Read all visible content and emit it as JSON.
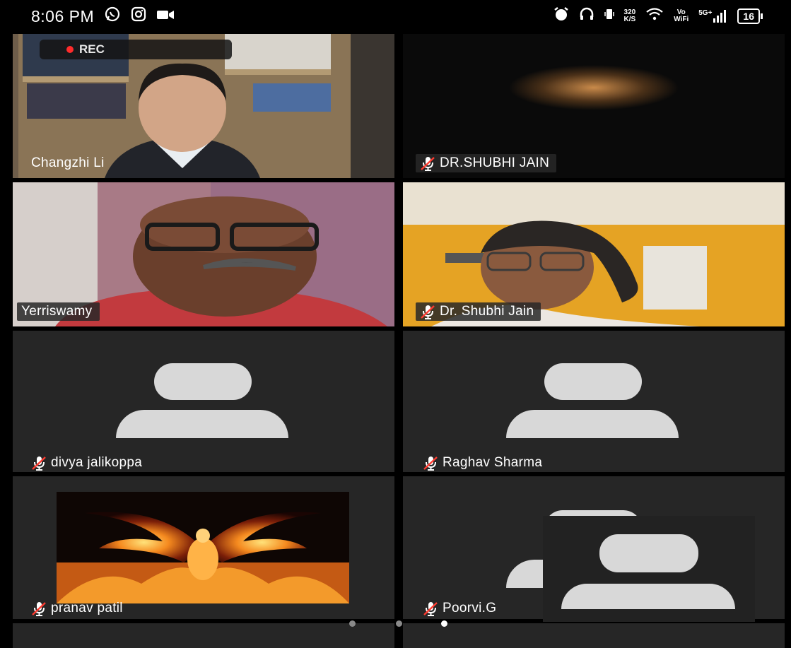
{
  "status_bar": {
    "time": "8:06 PM",
    "network_speed_value": "320",
    "network_speed_unit": "K/S",
    "vowifi_top": "Vo",
    "vowifi_bottom": "WiFi",
    "signal_label": "5G+",
    "battery": "16"
  },
  "recording": {
    "label": "REC"
  },
  "participants": [
    {
      "name": "Changzhi Li",
      "muted": false,
      "video": true
    },
    {
      "name": "DR.SHUBHI JAIN",
      "muted": true,
      "video": true
    },
    {
      "name": "Yerriswamy",
      "muted": false,
      "video": true,
      "active_speaker": true
    },
    {
      "name": "Dr. Shubhi Jain",
      "muted": true,
      "video": true
    },
    {
      "name": "divya jalikoppa",
      "muted": true,
      "video": false
    },
    {
      "name": "Raghav Sharma",
      "muted": true,
      "video": false
    },
    {
      "name": "pranav patil",
      "muted": true,
      "video": false
    },
    {
      "name": "Poorvi.G",
      "muted": true,
      "video": false
    }
  ],
  "pagination": {
    "pages": 3,
    "current": 3
  },
  "colors": {
    "active_border": "#3ec74a",
    "rec_dot": "#ff2b2b",
    "tile_bg": "#262626"
  }
}
